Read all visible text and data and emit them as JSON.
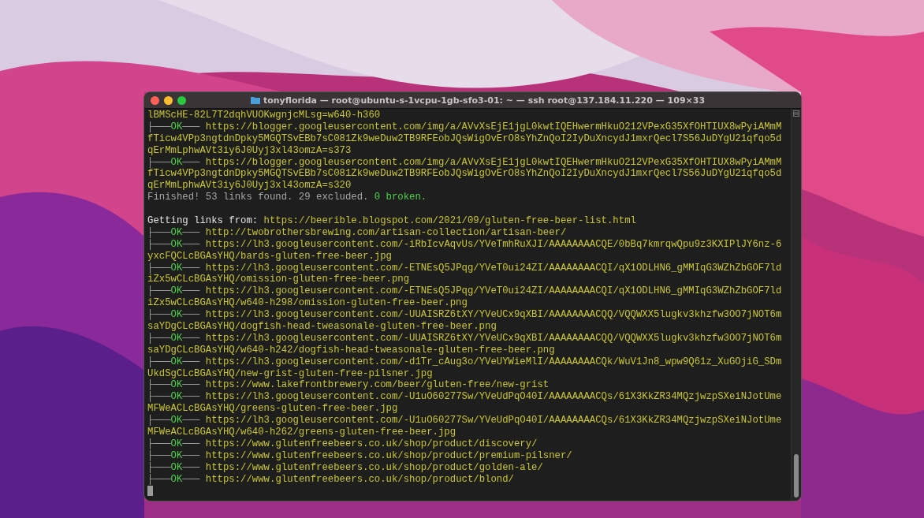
{
  "window": {
    "title": "tonyflorida — root@ubuntu-s-1vcpu-1gb-sfo3-01: ~ — ssh root@137.184.11.220 — 109×33"
  },
  "lines": [
    {
      "kind": "text",
      "text": "lBMScHE-82L7T2dqhVUOKwgnjcMLsg=w640-h360"
    },
    {
      "kind": "result",
      "branch": "├───",
      "status": "OK",
      "dash": "───",
      "url": "https://blogger.googleusercontent.com/img/a/AVvXsEjE1jgL0kwtIQEHwermHkuO212VPexG35XfOHTIUX8wPyiAMmM"
    },
    {
      "kind": "text",
      "text": "fTicw4VPp3ngtdnDpky5MGQTSvEBb7sC081Zk9weDuw2TB9RFEobJQsWigOvErO8sYhZnQoI2IyDuXncydJ1mxrQecl7S56JuDYgU21qfqo5d"
    },
    {
      "kind": "text",
      "text": "qErMmLphwAVt3iy6J0Uyj3xl43omzA=s373"
    },
    {
      "kind": "result",
      "branch": "├───",
      "status": "OK",
      "dash": "───",
      "url": "https://blogger.googleusercontent.com/img/a/AVvXsEjE1jgL0kwtIQEHwermHkuO212VPexG35XfOHTIUX8wPyiAMmM"
    },
    {
      "kind": "text",
      "text": "fTicw4VPp3ngtdnDpky5MGQTSvEBb7sC081Zk9weDuw2TB9RFEobJQsWigOvErO8sYhZnQoI2IyDuXncydJ1mxrQecl7S56JuDYgU21qfqo5d"
    },
    {
      "kind": "text",
      "text": "qErMmLphwAVt3iy6J0Uyj3xl43omzA=s320"
    },
    {
      "kind": "summary",
      "text": "Finished! 53 links found. 29 excluded.",
      "broken": "0 broken."
    },
    {
      "kind": "blank"
    },
    {
      "kind": "header",
      "label": "Getting links from:",
      "url": "https://beerible.blogspot.com/2021/09/gluten-free-beer-list.html"
    },
    {
      "kind": "result",
      "branch": "├───",
      "status": "OK",
      "dash": "───",
      "url": "http://twobrothersbrewing.com/artisan-collection/artisan-beer/"
    },
    {
      "kind": "result",
      "branch": "├───",
      "status": "OK",
      "dash": "───",
      "url": "https://lh3.googleusercontent.com/-iRbIcvAqvUs/YVeTmhRuXJI/AAAAAAAACQE/0bBq7kmrqwQpu9z3KXIPlJY6nz-6"
    },
    {
      "kind": "text",
      "text": "yxcFQCLcBGAsYHQ/bards-gluten-free-beer.jpg"
    },
    {
      "kind": "result",
      "branch": "├───",
      "status": "OK",
      "dash": "───",
      "url": "https://lh3.googleusercontent.com/-ETNEsQ5JPqg/YVeT0ui24ZI/AAAAAAAACQI/qX1ODLHN6_gMMIqG3WZhZbGOF7ld"
    },
    {
      "kind": "text",
      "text": "iZx5wCLcBGAsYHQ/omission-gluten-free-beer.png"
    },
    {
      "kind": "result",
      "branch": "├───",
      "status": "OK",
      "dash": "───",
      "url": "https://lh3.googleusercontent.com/-ETNEsQ5JPqg/YVeT0ui24ZI/AAAAAAAACQI/qX1ODLHN6_gMMIqG3WZhZbGOF7ld"
    },
    {
      "kind": "text",
      "text": "iZx5wCLcBGAsYHQ/w640-h298/omission-gluten-free-beer.png"
    },
    {
      "kind": "result",
      "branch": "├───",
      "status": "OK",
      "dash": "───",
      "url": "https://lh3.googleusercontent.com/-UUAISRZ6tXY/YVeUCx9qXBI/AAAAAAAACQQ/VQQWXX5lugkv3khzfw3OO7jNOT6m"
    },
    {
      "kind": "text",
      "text": "saYDgCLcBGAsYHQ/dogfish-head-tweasonale-gluten-free-beer.png"
    },
    {
      "kind": "result",
      "branch": "├───",
      "status": "OK",
      "dash": "───",
      "url": "https://lh3.googleusercontent.com/-UUAISRZ6tXY/YVeUCx9qXBI/AAAAAAAACQQ/VQQWXX5lugkv3khzfw3OO7jNOT6m"
    },
    {
      "kind": "text",
      "text": "saYDgCLcBGAsYHQ/w640-h242/dogfish-head-tweasonale-gluten-free-beer.png"
    },
    {
      "kind": "result",
      "branch": "├───",
      "status": "OK",
      "dash": "───",
      "url": "https://lh3.googleusercontent.com/-d1Tr_cAug3o/YVeUYWieMlI/AAAAAAAACQk/WuV1Jn8_wpw9Q61z_XuGOjiG_SDm"
    },
    {
      "kind": "text",
      "text": "UkdSgCLcBGAsYHQ/new-grist-gluten-free-pilsner.jpg"
    },
    {
      "kind": "result",
      "branch": "├───",
      "status": "OK",
      "dash": "───",
      "url": "https://www.lakefrontbrewery.com/beer/gluten-free/new-grist"
    },
    {
      "kind": "result",
      "branch": "├───",
      "status": "OK",
      "dash": "───",
      "url": "https://lh3.googleusercontent.com/-U1uO60277Sw/YVeUdPqO40I/AAAAAAAACQs/61X3KkZR34MQzjwzpSXeiNJotUme"
    },
    {
      "kind": "text",
      "text": "MFWeACLcBGAsYHQ/greens-gluten-free-beer.jpg"
    },
    {
      "kind": "result",
      "branch": "├───",
      "status": "OK",
      "dash": "───",
      "url": "https://lh3.googleusercontent.com/-U1uO60277Sw/YVeUdPqO40I/AAAAAAAACQs/61X3KkZR34MQzjwzpSXeiNJotUme"
    },
    {
      "kind": "text",
      "text": "MFWeACLcBGAsYHQ/w640-h262/greens-gluten-free-beer.jpg"
    },
    {
      "kind": "result",
      "branch": "├───",
      "status": "OK",
      "dash": "───",
      "url": "https://www.glutenfreebeers.co.uk/shop/product/discovery/"
    },
    {
      "kind": "result",
      "branch": "├───",
      "status": "OK",
      "dash": "───",
      "url": "https://www.glutenfreebeers.co.uk/shop/product/premium-pilsner/"
    },
    {
      "kind": "result",
      "branch": "├───",
      "status": "OK",
      "dash": "───",
      "url": "https://www.glutenfreebeers.co.uk/shop/product/golden-ale/"
    },
    {
      "kind": "result",
      "branch": "├───",
      "status": "OK",
      "dash": "───",
      "url": "https://www.glutenfreebeers.co.uk/shop/product/blond/"
    },
    {
      "kind": "cursor"
    }
  ]
}
